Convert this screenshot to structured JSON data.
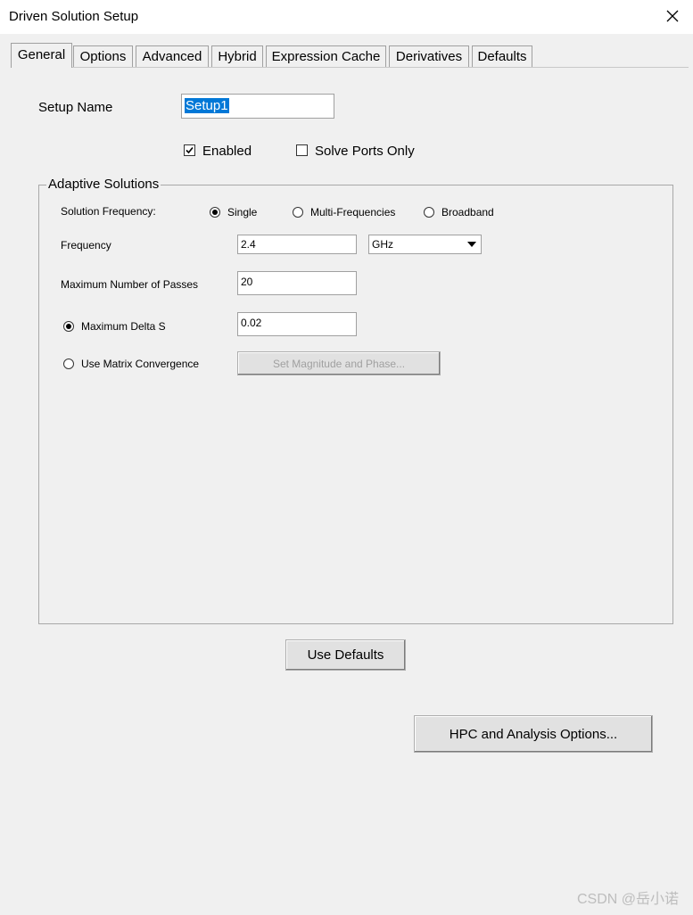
{
  "window": {
    "title": "Driven Solution Setup"
  },
  "tabs": [
    {
      "label": "General",
      "active": true
    },
    {
      "label": "Options"
    },
    {
      "label": "Advanced"
    },
    {
      "label": "Hybrid"
    },
    {
      "label": "Expression Cache"
    },
    {
      "label": "Derivatives"
    },
    {
      "label": "Defaults"
    }
  ],
  "general": {
    "setup_name_label": "Setup Name",
    "setup_name_value": "Setup1",
    "enabled_label": "Enabled",
    "enabled_checked": true,
    "solve_ports_only_label": "Solve Ports Only",
    "solve_ports_only_checked": false
  },
  "adaptive": {
    "group_title": "Adaptive Solutions",
    "solution_frequency_label": "Solution Frequency:",
    "freq_options": [
      "Single",
      "Multi-Frequencies",
      "Broadband"
    ],
    "freq_selected": "Single",
    "frequency_label": "Frequency",
    "frequency_value": "2.4",
    "frequency_unit": "GHz",
    "max_passes_label": "Maximum Number of Passes",
    "max_passes_value": "20",
    "max_delta_s_label": "Maximum Delta S",
    "max_delta_s_value": "0.02",
    "use_matrix_label": "Use Matrix Convergence",
    "set_mag_phase_label": "Set Magnitude and Phase..."
  },
  "buttons": {
    "use_defaults": "Use Defaults",
    "hpc": "HPC and Analysis Options..."
  },
  "watermark": "CSDN @岳小诺",
  "colors": {
    "selection": "#0078d7",
    "window_bg": "#f0f0f0"
  }
}
